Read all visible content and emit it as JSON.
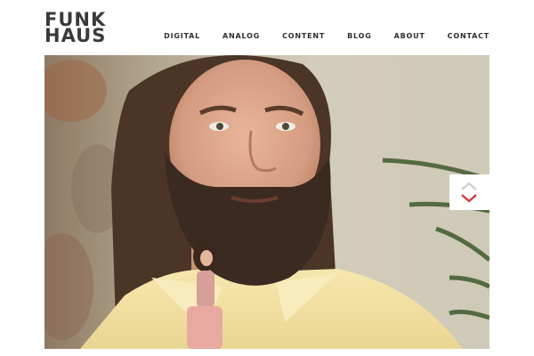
{
  "header": {
    "logo_line1": "FUNK",
    "logo_line2": "HAUS",
    "nav": [
      {
        "label": "DIGITAL"
      },
      {
        "label": "ANALOG"
      },
      {
        "label": "CONTENT"
      },
      {
        "label": "BLOG"
      },
      {
        "label": "ABOUT"
      },
      {
        "label": "CONTACT"
      }
    ]
  },
  "hero": {
    "slider_prev_icon": "chevron-up-icon",
    "slider_next_icon": "chevron-down-icon"
  },
  "colors": {
    "text_dark": "#3a3a3a",
    "arrow_inactive": "#cfcfcf",
    "arrow_active": "#d3343a",
    "shirt": "#f2e2a4",
    "beard": "#3a2a20"
  }
}
